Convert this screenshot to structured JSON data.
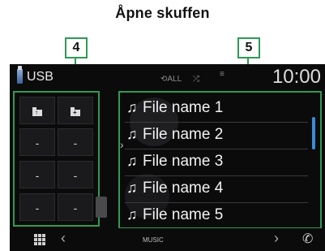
{
  "caption": "Åpne skuffen",
  "callouts": {
    "drawer": "4",
    "list": "5"
  },
  "statusbar": {
    "source": "USB",
    "icons": {
      "repeat": "⟲ALL",
      "shuffle": "⤮",
      "signal": "≡"
    },
    "time": "10:00"
  },
  "drawer": {
    "buttons": [
      {
        "icon": "folder-up-icon",
        "symbol": "↑"
      },
      {
        "icon": "folder-add-icon",
        "symbol": "+"
      },
      {
        "label": "-"
      },
      {
        "label": "-"
      },
      {
        "label": "-"
      },
      {
        "label": "-"
      },
      {
        "label": "-"
      },
      {
        "label": "-"
      }
    ]
  },
  "file_list": {
    "note_symbol": "♫",
    "items": [
      "File name 1",
      "File name 2",
      "File name 3",
      "File name 4",
      "File name 5"
    ]
  },
  "bottombar": {
    "left_arrow": "‹",
    "label": "MUSIC",
    "right_arrow": "›",
    "phone": "✆"
  },
  "colors": {
    "callout_green": "#2f9a55",
    "scroll_blue": "#3b8cd6",
    "screen_bg": "#0b0b0c"
  }
}
